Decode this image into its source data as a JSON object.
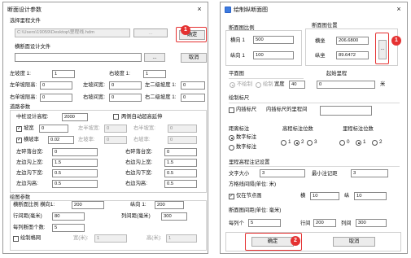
{
  "left": {
    "title": "断面设计参数",
    "select_file_label": "选择里程文件",
    "file_path": "C:\\Users\\19059\\Desktop\\里程线.hdm",
    "browse1_label": "...",
    "ok_label": "确定",
    "section_file_label": "横断面设计文件",
    "section_file_value": "",
    "browse2_label": "...",
    "cancel_label": "取消",
    "row1": {
      "l1": "左坡度 1:",
      "v1": "1",
      "l2": "右坡度 1:",
      "v2": "1"
    },
    "row2": {
      "l1": "左单坡限高:",
      "v1": "0",
      "l2": "左坡间宽:",
      "v2": "0",
      "l3": "左二级坡度 1:",
      "v3": "0"
    },
    "row3": {
      "l1": "右单坡限高:",
      "v1": "0",
      "l2": "右坡间宽:",
      "v2": "0",
      "l3": "右二级坡度 1:",
      "v3": "0"
    },
    "road_group": "道路参数",
    "center_height_label": "中桩设计高程:",
    "center_height_value": "2000",
    "auto_super_label": "两侧自动超高延伸",
    "slope_label": "坡宽",
    "slope_value": "0",
    "left_slope_label": "左半坡宽:",
    "left_slope_value": "0",
    "right_slope_label": "右半坡宽:",
    "right_slope_value": "0",
    "crossfall_label": "横坡率",
    "crossfall_value": "0.02",
    "left_dis_label": "左坡率:",
    "left_dis_value": "0",
    "right_dis_label": "右坡率:",
    "right_dis_value": "0",
    "pr1": {
      "l1": "左碎落台宽:",
      "v1": "0",
      "l2": "右碎落台宽:",
      "v2": "0"
    },
    "pr2": {
      "l1": "左边沟上宽:",
      "v1": "1.5",
      "l2": "右边沟上宽:",
      "v2": "1.5"
    },
    "pr3": {
      "l1": "左边沟下宽:",
      "v1": "0.5",
      "l2": "右边沟下宽:",
      "v2": "0.5"
    },
    "pr4": {
      "l1": "左边沟高:",
      "v1": "0.5",
      "l2": "右边沟高:",
      "v2": "0.5"
    },
    "draw_group": "绘图参数",
    "hscale_label": "横断面比例 横向1:",
    "hscale_value": "200",
    "vscale_label": "纵向 1:",
    "vscale_value": "200",
    "rowgap_label": "行间距(毫米)",
    "rowgap_value": "80",
    "colgap_label": "列间距(毫米)",
    "colgap_value": "300",
    "perrow_label": "每列断面个数:",
    "perrow_value": "5",
    "grid_label": "绘制格网",
    "gw_label": "宽(米):",
    "gw_value": "1",
    "gh_label": "高(米):",
    "gh_value": "1",
    "badge": "1"
  },
  "right": {
    "title": "绘制纵断面图",
    "scale_group": "断面图比例",
    "h_label": "横向 1",
    "h_value": "500",
    "v_label": "纵向 1",
    "v_value": "100",
    "pos_group": "断面图位置",
    "x_label": "横坐",
    "x_value": "206.6800",
    "y_label": "纵坐",
    "y_value": "89.6472",
    "pick_label": "...",
    "badge1": "1",
    "plan_group": "平面图",
    "no_draw_label": "不绘制",
    "draw_label": "绘制",
    "width_label": "宽度",
    "width_value": "40",
    "start_group": "起始里程",
    "start_value": "0",
    "start_unit": "米",
    "ruler_group": "绘制标尺",
    "inner_ruler_label": "内插标尺",
    "inner_ruler_spacing_label": "内插标尺的里程间",
    "inner_ruler_spacing_value": "",
    "mileage_group": "距离标注",
    "m_opt1": "数字标注",
    "m_opt2": "数字标注",
    "elev_group": "高程标注位数",
    "elev_1": "1",
    "elev_2": "2",
    "elev_3": "3",
    "mil_digits_group": "里程标注位数",
    "md_0": "0",
    "md_1": "1",
    "md_2": "2",
    "mileage_group2": "里程高程注记设置",
    "font_size_label": "文字大小",
    "font_size_value": "3",
    "min_label_label": "最小注记距",
    "min_label_value": "3",
    "grid_group": "方格线间隔(单位: 米)",
    "only_node_label": "仅在节点画",
    "gx_label": "横",
    "gx_value": "10",
    "gy_label": "纵",
    "gy_value": "10",
    "section_gap_group": "断面图间距(单位: 毫米)",
    "per_label": "每列个",
    "per_value": "5",
    "row_label": "行间",
    "row_value": "200",
    "col_label": "列间",
    "col_value": "300",
    "ok_label": "确定",
    "badge2": "2",
    "cancel_label": "取消"
  },
  "close_glyph": "×",
  "check_glyph": "✓"
}
